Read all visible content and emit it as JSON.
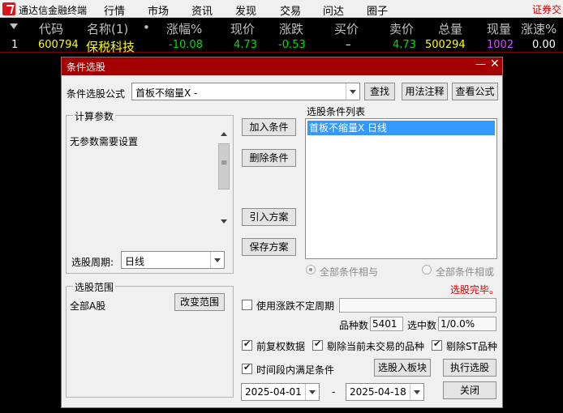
{
  "menubar": {
    "app_title": "通达信金融终端",
    "items": [
      "行情",
      "市场",
      "资讯",
      "发现",
      "交易",
      "问达",
      "圈子"
    ],
    "right_text": "证券交"
  },
  "quote_table": {
    "headers": [
      "代码",
      "名称(1)",
      "•",
      "涨幅%",
      "现价",
      "涨跌",
      "买价",
      "卖价",
      "总量",
      "现量",
      "涨速%"
    ],
    "row": {
      "index": "1",
      "code": "600794",
      "name": "保税科技",
      "change_pct": "-10.08",
      "price": "4.73",
      "change": "-0.53",
      "bid": "–",
      "ask": "4.73",
      "volume": "500294",
      "cur_volume": "1002",
      "speed": "0.00"
    },
    "colors": {
      "code": "#ffff00",
      "name": "#ffff00",
      "down": "#00e000",
      "volume": "#ffff00",
      "cur_volume": "#d050ff",
      "header": "#c0c0c0",
      "white": "#ffffff"
    }
  },
  "dialog": {
    "title": "条件选股",
    "formula_label": "条件选股公式",
    "formula_value": "首板不缩量X  -",
    "find_button": "查找",
    "usage_button": "用法注释",
    "view_formula_button": "查看公式",
    "params_group_title": "计算参数",
    "params_text": "无参数需要设置",
    "period_label": "选股周期:",
    "period_value": "日线",
    "add_condition_button": "加入条件",
    "delete_condition_button": "删除条件",
    "import_scheme_button": "引入方案",
    "save_scheme_button": "保存方案",
    "condition_list_label": "选股条件列表",
    "condition_list_items": [
      "首板不缩量X  日线"
    ],
    "radio_and": "全部条件相与",
    "radio_or": "全部条件相或",
    "status_text": "选股完毕。",
    "scope_group_title": "选股范围",
    "scope_value": "全部A股",
    "change_scope_button": "改变范围",
    "use_period_label": "使用涨跌不定周期",
    "stock_count_label": "品种数",
    "stock_count_value": "5401",
    "selected_count_label": "选中数",
    "selected_count_value": "1/0.0%",
    "pre_adjust_label": "前复权数据",
    "remove_untraded_label": "剔除当前未交易的品种",
    "remove_st_label": "剔除ST品种",
    "time_range_label": "时间段内满足条件",
    "to_block_button": "选股入板块",
    "execute_button": "执行选股",
    "date_from": "2025-04-01",
    "date_sep": "-",
    "date_to": "2025-04-18",
    "close_button": "关闭",
    "title_bar_color": "#a40000",
    "status_color": "#e00000"
  }
}
